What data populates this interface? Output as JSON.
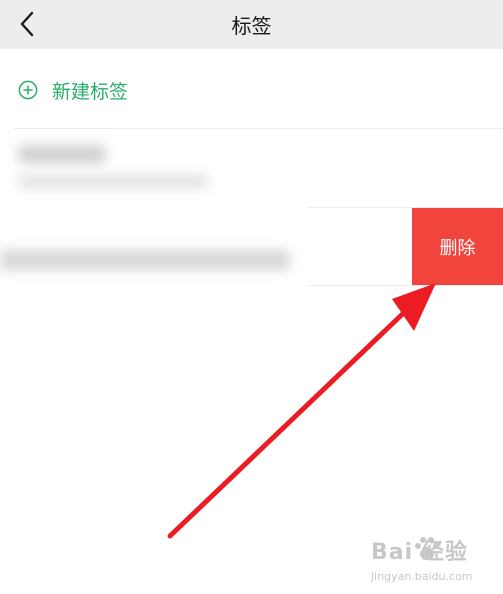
{
  "nav": {
    "title": "标签"
  },
  "actions": {
    "new_tag_label": "新建标签"
  },
  "tags": [
    {
      "status": "blurred"
    },
    {
      "status": "blurred"
    }
  ],
  "swipe_action": {
    "delete_label": "删除",
    "color": "#f0443c"
  },
  "accent_color": "#2aae67",
  "annotation_arrow_color": "#ec1c24",
  "watermark": {
    "brand": "Bai  经验",
    "url": "jingyan.baidu.com"
  }
}
